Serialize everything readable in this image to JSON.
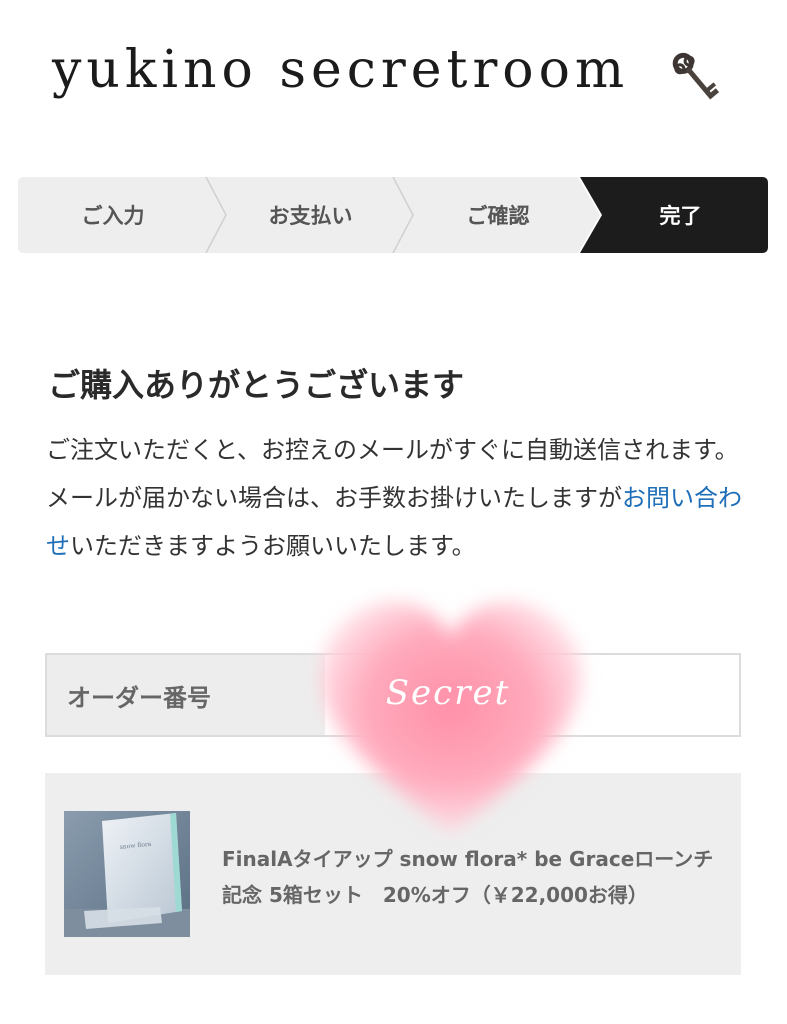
{
  "header": {
    "logo_text": "yukino secretroom",
    "logo_icon": "key-icon"
  },
  "steps": [
    {
      "label": "ご入力",
      "active": false
    },
    {
      "label": "お支払い",
      "active": false
    },
    {
      "label": "ご確認",
      "active": false
    },
    {
      "label": "完了",
      "active": true
    }
  ],
  "main": {
    "title": "ご購入ありがとうございます",
    "message_line1": "ご注文いただくと、お控えのメールがすぐに自動送信されます。",
    "message_line2_before": "メールが届かない場合は、お手数お掛けいたしますが",
    "message_link": "お問い合わせ",
    "message_line2_after": "いただきますようお願いいたします。"
  },
  "order": {
    "label": "オーダー番号",
    "value": ""
  },
  "product": {
    "name": "FinalAタイアップ snow flora* be Graceローンチ記念 5箱セット　20%オフ（￥22,000お得）",
    "thumb_text": "snow flora"
  },
  "overlay": {
    "sticker_text": "Secret"
  },
  "colors": {
    "active_step_bg": "#1c1c1c",
    "inactive_step_bg": "#eeeeee",
    "link": "#1e6fb8",
    "product_bg": "#eeeeee"
  }
}
